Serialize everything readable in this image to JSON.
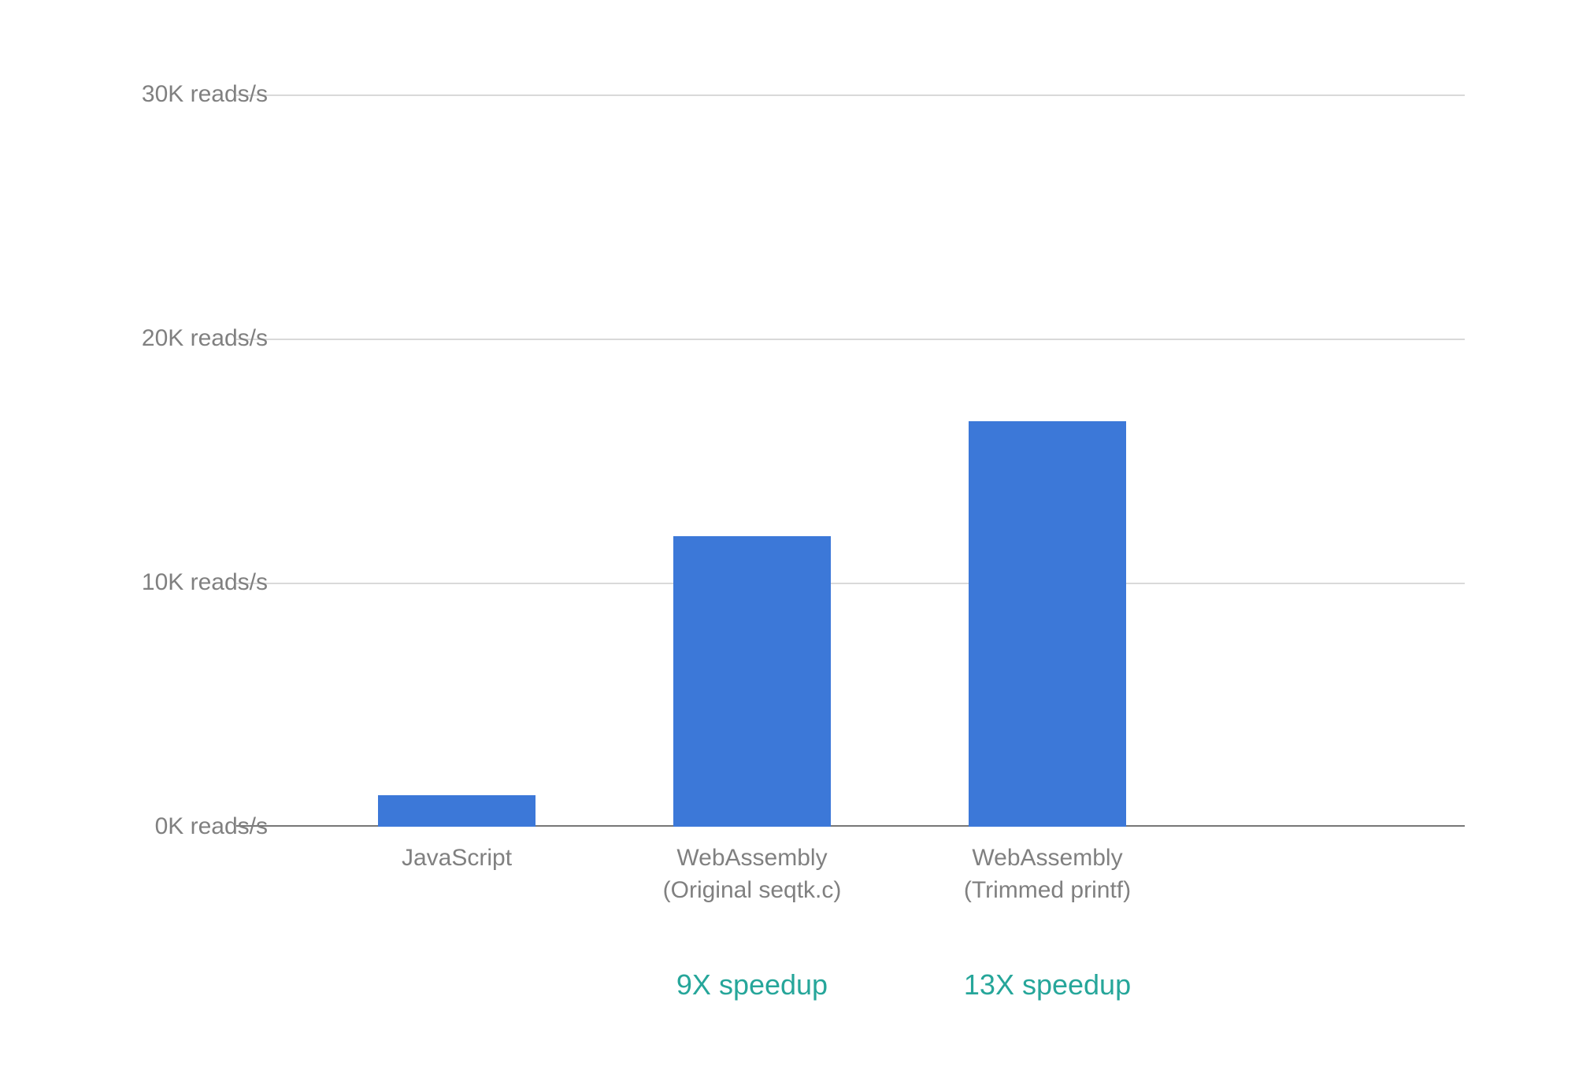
{
  "chart_data": {
    "type": "bar",
    "categories": [
      "JavaScript",
      "WebAssembly\n(Original seqtk.c)",
      "WebAssembly\n(Trimmed printf)"
    ],
    "values": [
      1.3,
      11.9,
      16.6
    ],
    "y_ticks": [
      0,
      10,
      20,
      30
    ],
    "y_tick_labels": [
      "0K reads/s",
      "10K reads/s",
      "20K reads/s",
      "30K reads/s"
    ],
    "ylim": [
      0,
      30
    ],
    "ylabel_units": "K reads/s",
    "annotations": [
      {
        "index": 1,
        "text": "9X speedup",
        "color": "#26a69a"
      },
      {
        "index": 2,
        "text": "13X speedup",
        "color": "#26a69a"
      }
    ],
    "bar_color": "#3c78d8"
  }
}
